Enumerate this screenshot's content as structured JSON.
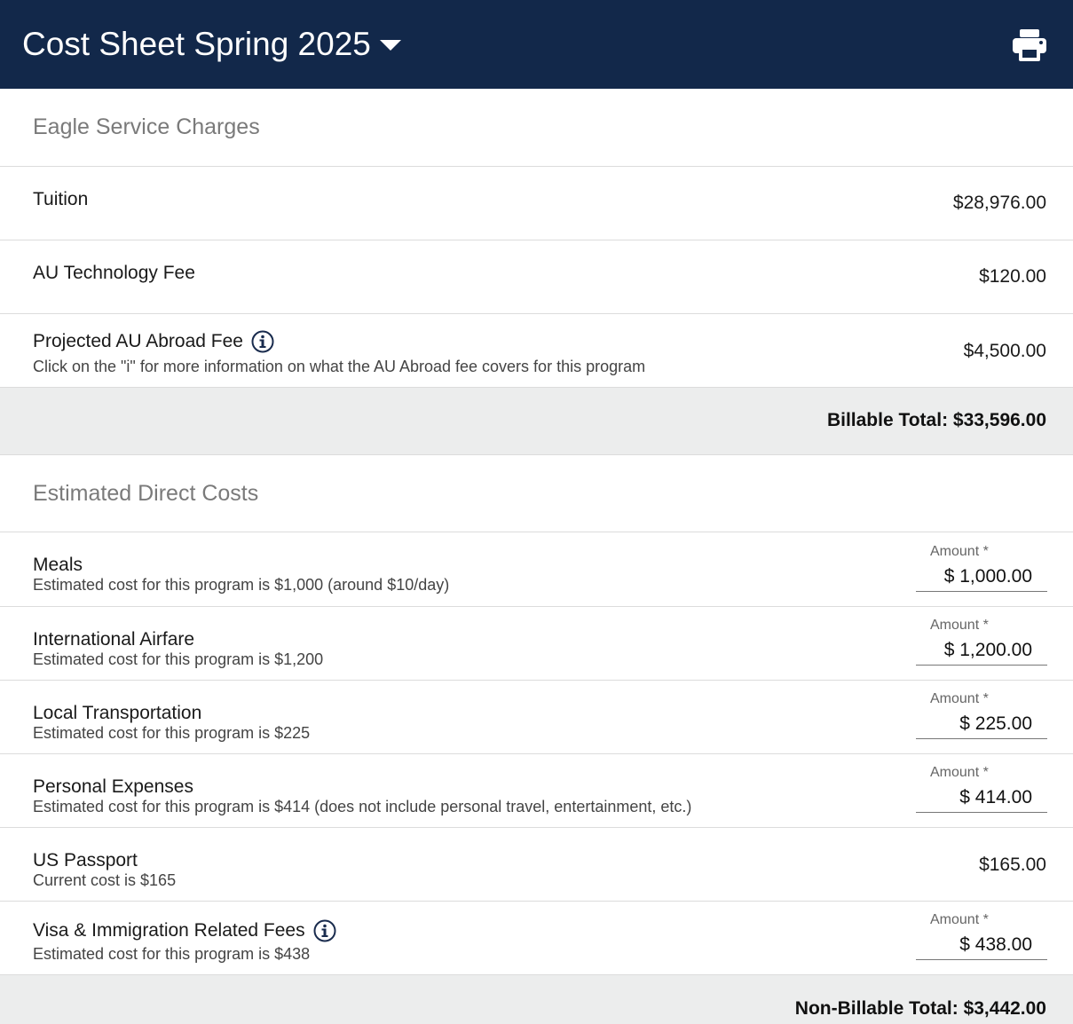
{
  "header": {
    "title": "Cost Sheet Spring 2025",
    "print_icon": "printer-icon",
    "dropdown_icon": "caret-down-icon"
  },
  "billable": {
    "section_title": "Eagle Service Charges",
    "items": [
      {
        "label": "Tuition",
        "value": "$28,976.00"
      },
      {
        "label": "AU Technology Fee",
        "value": "$120.00"
      },
      {
        "label": "Projected AU Abroad Fee",
        "sub": "Click on the \"i\" for more information on what the AU Abroad fee covers for this program",
        "value": "$4,500.00",
        "info_icon": "info-icon"
      }
    ],
    "total": "Billable Total: $33,596.00"
  },
  "direct": {
    "section_title": "Estimated Direct Costs",
    "amount_label": "Amount *",
    "items": [
      {
        "label": "Meals",
        "sub": "Estimated cost for this program is $1,000 (around $10/day)",
        "value": "$ 1,000.00"
      },
      {
        "label": "International Airfare",
        "sub": "Estimated cost for this program is $1,200",
        "value": "$ 1,200.00"
      },
      {
        "label": "Local Transportation",
        "sub": "Estimated cost for this program is $225",
        "value": "$ 225.00"
      },
      {
        "label": "Personal Expenses",
        "sub": "Estimated cost for this program is $414 (does not include personal travel, entertainment, etc.)",
        "value": "$ 414.00"
      },
      {
        "label": "US Passport",
        "sub": "Current cost is $165",
        "value": "$165.00"
      },
      {
        "label": "Visa & Immigration Related Fees",
        "sub": "Estimated cost for this program is $438",
        "value": "$ 438.00",
        "info_icon": "info-icon"
      }
    ],
    "total": "Non-Billable Total: $3,442.00"
  },
  "colors": {
    "header_bg": "#12284a",
    "total_bg": "#eceded",
    "section_title": "#7a7a7a"
  }
}
